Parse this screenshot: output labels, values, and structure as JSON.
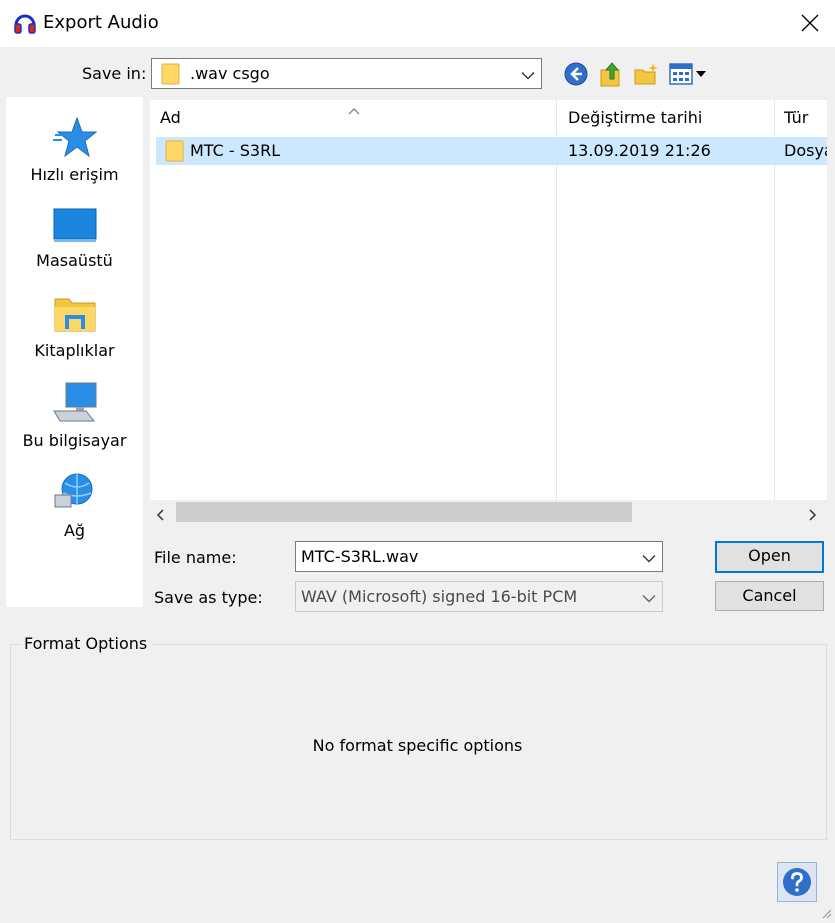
{
  "window": {
    "title": "Export Audio",
    "app_icon": "headphones-icon"
  },
  "toolbar": {
    "save_in_label": "Save in:",
    "save_in_value": ".wav csgo",
    "buttons": [
      "back-icon",
      "up-folder-icon",
      "new-folder-icon",
      "view-menu-icon"
    ]
  },
  "sidebar": {
    "items": [
      {
        "label": "Hızlı erişim",
        "icon": "quick-access-star-icon"
      },
      {
        "label": "Masaüstü",
        "icon": "desktop-icon"
      },
      {
        "label": "Kitaplıklar",
        "icon": "libraries-icon"
      },
      {
        "label": "Bu bilgisayar",
        "icon": "this-pc-icon"
      },
      {
        "label": "Ağ",
        "icon": "network-icon"
      }
    ]
  },
  "filelist": {
    "columns": [
      "Ad",
      "Değiştirme tarihi",
      "Tür"
    ],
    "rows": [
      {
        "name": "MTC - S3RL",
        "modified": "13.09.2019 21:26",
        "type": "Dosya"
      }
    ]
  },
  "form": {
    "filename_label": "File name:",
    "filename_value": "MTC-S3RL.wav",
    "type_label": "Save as type:",
    "type_value": "WAV (Microsoft) signed 16-bit PCM",
    "open_label": "Open",
    "cancel_label": "Cancel"
  },
  "format_options": {
    "title": "Format Options",
    "message": "No format specific options"
  },
  "colors": {
    "selection": "#cce8ff",
    "accent": "#0078d7",
    "folder": "#ffd766"
  }
}
